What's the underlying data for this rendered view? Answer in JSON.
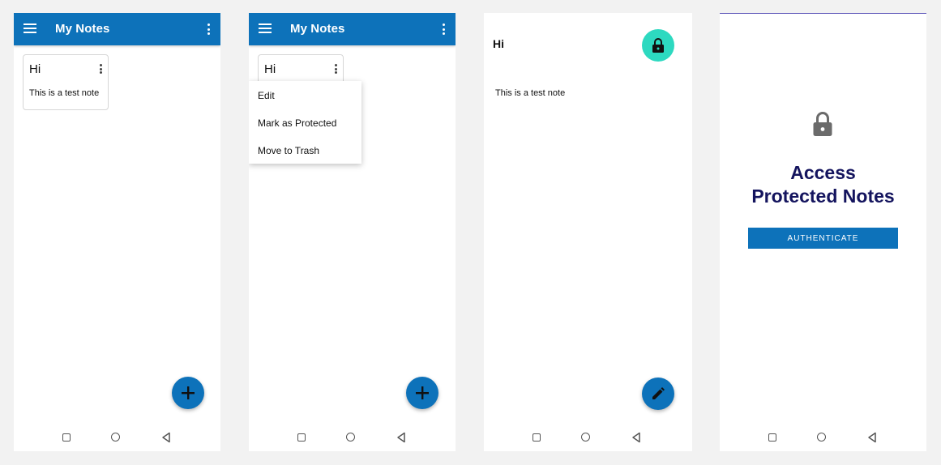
{
  "screens": [
    {
      "appbar": {
        "title": "My Notes",
        "menu_icon": "hamburger-menu-icon",
        "more_icon": "more-vert-icon"
      },
      "note": {
        "title": "Hi",
        "body": "This is a test note"
      },
      "fab_icon": "add-icon"
    },
    {
      "appbar": {
        "title": "My Notes",
        "menu_icon": "hamburger-menu-icon",
        "more_icon": "more-vert-icon"
      },
      "note": {
        "title": "Hi"
      },
      "menu": {
        "items": [
          "Edit",
          "Mark as Protected",
          "Move to Trash"
        ]
      },
      "fab_icon": "add-icon"
    },
    {
      "note": {
        "title": "Hi",
        "body": "This is a test note"
      },
      "lock_icon": "lock-icon",
      "fab_icon": "edit-pencil-icon"
    },
    {
      "heading_line1": "Access",
      "heading_line2": "Protected Notes",
      "button_label": "AUTHENTICATE",
      "lock_icon": "lock-icon"
    }
  ],
  "navbar": {
    "icons": [
      "recents-square-icon",
      "home-circle-icon",
      "back-triangle-icon"
    ]
  },
  "colors": {
    "primary": "#0d72ba",
    "accent_teal": "#2dd9c0",
    "heading_navy": "#14145e",
    "background": "#f2f2f2"
  }
}
